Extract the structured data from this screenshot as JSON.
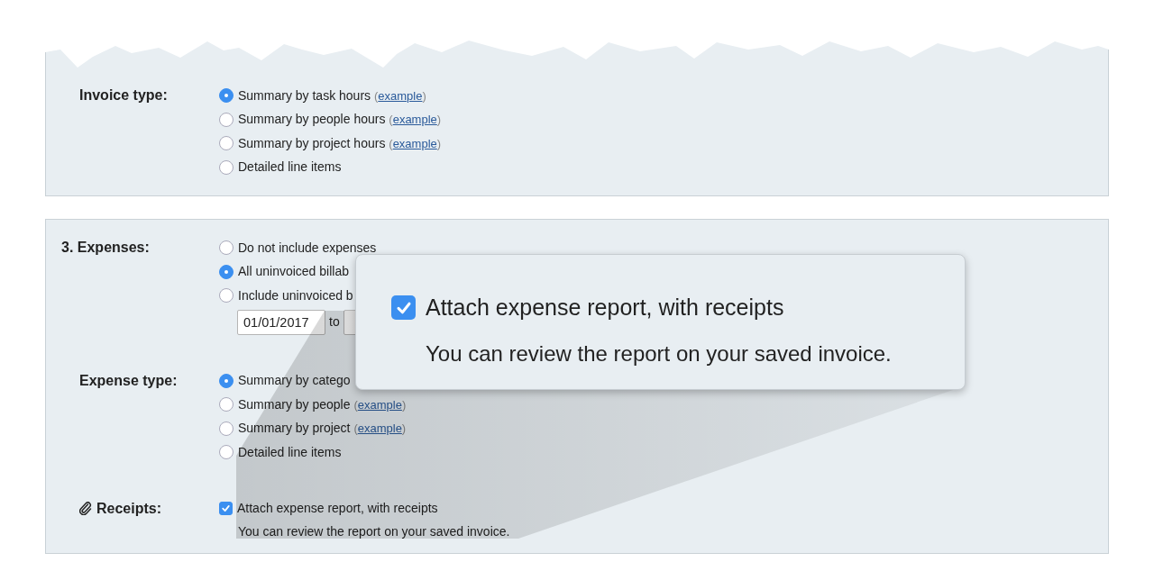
{
  "sections": [
    {
      "groups": [
        {
          "kind": "plain",
          "label": "Invoice type:",
          "options": [
            {
              "kind": "radio",
              "text": "Summary by task hours",
              "link": {
                "open": "(",
                "text": "example",
                "close": ")"
              },
              "selected": true
            },
            {
              "kind": "radio",
              "text": "Summary by people hours",
              "link": {
                "open": "(",
                "text": "example",
                "close": ")"
              },
              "selected": false
            },
            {
              "kind": "radio",
              "text": "Summary by project hours",
              "link": {
                "open": "(",
                "text": "example",
                "close": ")"
              },
              "selected": false
            },
            {
              "kind": "radio",
              "text": "Detailed line items",
              "selected": false
            }
          ]
        }
      ]
    },
    {
      "groups": [
        {
          "kind": "numbered",
          "label": "3. Expenses:",
          "options": [
            {
              "kind": "radio",
              "text": "Do not include expenses",
              "selected": false
            },
            {
              "kind": "radio",
              "text": "All uninvoiced billab",
              "selected": true
            },
            {
              "kind": "radio",
              "text": "Include uninvoiced b",
              "selected": false
            },
            {
              "kind": "dates",
              "from": "01/01/2017",
              "sep": "to"
            }
          ]
        },
        {
          "kind": "plain",
          "label": "Expense type:",
          "options": [
            {
              "kind": "radio",
              "text": "Summary by catego",
              "selected": true
            },
            {
              "kind": "radio",
              "text": "Summary by people",
              "link": {
                "open": "(",
                "text": "example",
                "close": ")"
              },
              "selected": false
            },
            {
              "kind": "radio",
              "text": "Summary by project",
              "link": {
                "open": "(",
                "text": "example",
                "close": ")"
              },
              "selected": false
            },
            {
              "kind": "radio",
              "text": "Detailed line items",
              "selected": false
            }
          ]
        },
        {
          "kind": "attachment",
          "label": "Receipts:",
          "options": [
            {
              "kind": "checkbox",
              "text": "Attach expense report, with receipts",
              "checked": true
            },
            {
              "kind": "note",
              "text": "You can review the report on your saved invoice."
            }
          ]
        }
      ]
    }
  ],
  "callout": {
    "checkbox": {
      "text": "Attach expense report, with receipts",
      "checked": true
    },
    "note": "You can review the report on your saved invoice."
  }
}
